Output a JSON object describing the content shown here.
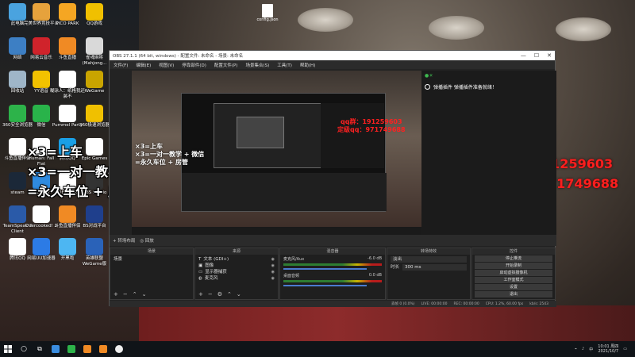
{
  "desktop": {
    "icons": [
      {
        "label": "此电脑",
        "color": "#4aa3df"
      },
      {
        "label": "完美世界竞技平台",
        "color": "#e6a23c"
      },
      {
        "label": "PICO PARK",
        "color": "#f5a623"
      },
      {
        "label": "QQ游戏",
        "color": "#f0c000"
      },
      {
        "label": "网络",
        "color": "#3d7fc4"
      },
      {
        "label": "网易云音乐",
        "color": "#d0232b"
      },
      {
        "label": "斗鱼直播",
        "color": "#f08a24"
      },
      {
        "label": "雀魂麻将 (Mahjong...",
        "color": "#d9d9d9"
      },
      {
        "label": "回收站",
        "color": "#9fb6c8"
      },
      {
        "label": "YY语音",
        "color": "#f2c200"
      },
      {
        "label": "糊涂人：纸格我还装不",
        "color": "#ffffff"
      },
      {
        "label": "WeGame",
        "color": "#c9a400"
      },
      {
        "label": "360安全浏览器",
        "color": "#2db34a"
      },
      {
        "label": "微信",
        "color": "#29b34a"
      },
      {
        "label": "Pummel Party",
        "color": "#ffffff"
      },
      {
        "label": "360极速浏览器",
        "color": "#f0c000"
      },
      {
        "label": "斗鱼直播伴侣",
        "color": "#ffffff"
      },
      {
        "label": "Human: Fall Flat",
        "color": "#ffffff"
      },
      {
        "label": "腾讯QQ",
        "color": "#1aa0e6"
      },
      {
        "label": "Epic Games",
        "color": "#ffffff"
      },
      {
        "label": "steam",
        "color": "#1b2838"
      },
      {
        "label": "迅雷影音",
        "color": "#2f8be0"
      },
      {
        "label": "DEVOUR",
        "color": "#ffffff"
      },
      {
        "label": "OBS Studio",
        "color": "#333333"
      },
      {
        "label": "TeamSpeak 3 Client",
        "color": "#2a5aa8"
      },
      {
        "label": "Overcooked! 2",
        "color": "#ffffff"
      },
      {
        "label": "斗鱼直播伴侣",
        "color": "#f08a24"
      },
      {
        "label": "BS对战平台",
        "color": "#1f3f8c"
      },
      {
        "label": "腾讯QQ",
        "color": "#ffffff"
      },
      {
        "label": "网易UU加速器",
        "color": "#2c7be5"
      },
      {
        "label": "开黑啦",
        "color": "#4db6f2"
      },
      {
        "label": "英雄联盟WeGame版",
        "color": "#2a62b8"
      }
    ],
    "top_file": "config.json",
    "overlay_left": [
      "×3=上车",
      "×3=一对一教学 + 微信",
      "=永久车位 + 房管"
    ],
    "overlay_right": [
      "qq群：191259603",
      "定级qq：971749688"
    ]
  },
  "obs": {
    "title": "OBS 27.1.1 (64 bit, windows) - 配置文件: 未命名 - 场景: 未命名",
    "menu": [
      "文件(F)",
      "编辑(E)",
      "视图(V)",
      "停靠部件(D)",
      "配置文件(P)",
      "场景集合(S)",
      "工具(T)",
      "帮助(H)"
    ],
    "window_buttons": [
      "—",
      "☐",
      "✕"
    ],
    "chat": {
      "header_icons": "●☀",
      "message": "弹播插件 弹播插件准备就绪！"
    },
    "scene_bar": [
      "+ 转场布局",
      "◎ 回放"
    ],
    "docks": {
      "scenes": {
        "title": "场景",
        "items": [
          "场景"
        ]
      },
      "sources": {
        "title": "来源",
        "items": [
          "文本 (GDI+)",
          "图像",
          "显示器捕获",
          "麦克风"
        ]
      },
      "mixer": {
        "title": "混音器",
        "tracks": [
          {
            "name": "麦克风/Aux",
            "db": "-6.0 dB"
          },
          {
            "name": "桌面音频",
            "db": "0.0 dB"
          }
        ]
      },
      "transitions": {
        "title": "转场特效",
        "type": "淡出",
        "duration_label": "时长",
        "duration": "300 ms"
      },
      "controls": {
        "title": "控件",
        "buttons": [
          "停止推流",
          "开始录制",
          "启动虚拟摄像机",
          "工作室模式",
          "设置",
          "退出"
        ]
      }
    },
    "status": {
      "drop": "丢帧 0 (0.0%)",
      "live": "LIVE: 00:00:00",
      "rec": "REC: 00:00:00",
      "cpu": "CPU: 1.2%, 60.00 fps",
      "kbps": "kb/s: 2543"
    }
  },
  "taskbar": {
    "time": "10:01 周四",
    "date": "2021/10/7",
    "ime": "中",
    "app_colors": [
      "#3a8de0",
      "#2db34a",
      "#f08a24",
      "#f08a24",
      "#eeeeee"
    ]
  }
}
